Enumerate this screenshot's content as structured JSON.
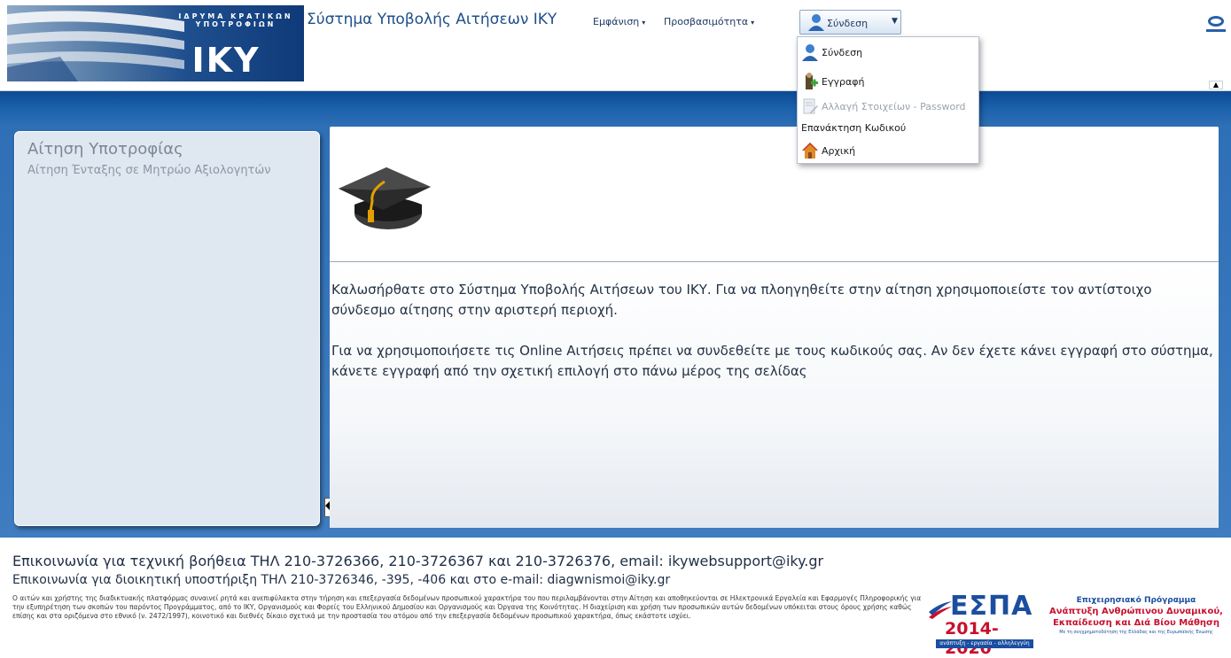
{
  "header": {
    "logo_text": "ΙΔΡΥΜΑ ΚΡΑΤΙΚΩΝ ΥΠΟΤΡΟΦΙΩΝ",
    "logo_big": "IKY",
    "app_title": "Σύστημα Υποβολής Αιτήσεων ΙΚΥ",
    "menu_appearance": "Εμφάνιση",
    "menu_accessibility": "Προσβασιμότητα",
    "login_button": "Σύνδεση"
  },
  "login_menu": {
    "items": [
      {
        "label": "Σύνδεση",
        "icon": "user-icon",
        "disabled": false
      },
      {
        "label": "Εγγραφή",
        "icon": "register-icon",
        "disabled": false
      },
      {
        "label": "Αλλαγή Στοιχείων - Password",
        "icon": "edit-document-icon",
        "disabled": true
      },
      {
        "label": "Επανάκτηση Κωδικού",
        "icon": "",
        "disabled": false
      },
      {
        "label": "Αρχική",
        "icon": "home-icon",
        "disabled": false
      }
    ]
  },
  "sidebar": {
    "title": "Αίτηση Υποτροφίας",
    "subtitle": "Αίτηση Ένταξης σε Μητρώο Αξιολογητών"
  },
  "main": {
    "welcome_1": "Καλωσήρθατε στο Σύστημα Υποβολής Αιτήσεων του ΙΚΥ. Για να πλοηγηθείτε στην αίτηση χρησιμοποιείστε τον αντίστοιχο σύνδεσμο αίτησης στην αριστερή περιοχή.",
    "welcome_2": "Για να χρησιμοποιήσετε τις Online Αιτήσεις πρέπει να συνδεθείτε με τους κωδικούς σας. Αν δεν έχετε κάνει εγγραφή στο σύστημα, κάνετε εγγραφή από την σχετική επιλογή στο πάνω μέρος της σελίδας"
  },
  "footer": {
    "support_line": "Επικοινωνία για τεχνική βοήθεια ΤΗΛ 210-3726366, 210-3726367 και 210-3726376, email: ikywebsupport@iky.gr",
    "admin_line": "Επικοινωνία για διοικητική υποστήριξη ΤΗΛ 210-3726346, -395, -406 και στο e-mail: diagwnismoi@iky.gr",
    "privacy": "Ο αιτών και χρήστης της διαδικτυακής πλατφόρμας συναινεί ρητά και ανεπιφύλακτα στην τήρηση και επεξεργασία δεδομένων προσωπικού χαρακτήρα του που περιλαμβάνονται στην Αίτηση και αποθηκεύονται σε Ηλεκτρονικά Εργαλεία και Εφαρμογές Πληροφορικής για την εξυπηρέτηση των σκοπών του παρόντος Προγράμματος, από το ΙΚΥ, Οργανισμούς και Φορείς του Ελληνικού Δημοσίου και Οργανισμούς και Όργανα της Κοινότητας. Η διαχείριση και χρήση των προσωπικών αυτών δεδομένων υπόκειται στους όρους χρήσης καθώς επίσης και στα οριζόμενα στο εθνικό (ν. 2472/1997), κοινοτικό και διεθνές δίκαιο σχετικά με την προστασία του ατόμου από την επεξεργασία δεδομένων προσωπικού χαρακτήρα, όπως εκάστοτε ισχύει.",
    "espa_title": "ΕΣΠΑ",
    "espa_years": "2014-2020",
    "espa_tag": "ανάπτυξη - εργασία - αλληλεγγύη",
    "op_title": "Επιχειρησιακό Πρόγραμμα",
    "op_line1": "Ανάπτυξη Ανθρώπινου Δυναμικού,",
    "op_line2": "Εκπαίδευση και Διά Βίου Μάθηση",
    "op_small": "Με τη συγχρηματοδότηση της Ελλάδας και της Ευρωπαϊκής Ένωσης"
  },
  "colors": {
    "band": "#1c62ad",
    "title_blue": "#1e4f8a",
    "espa_red": "#c8102e"
  }
}
